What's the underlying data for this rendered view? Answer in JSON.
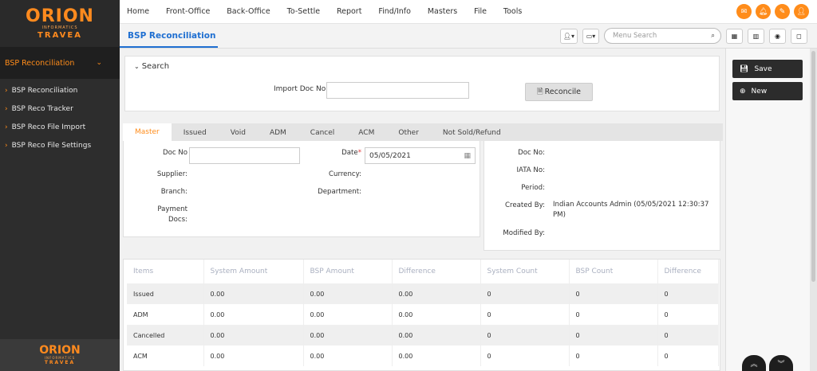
{
  "logo": {
    "line1": "RION",
    "line1_prefix": "O",
    "line2": "INFORMATICS",
    "line3": "TRAVEA"
  },
  "sidebar": {
    "header": "BSP Reconciliation",
    "items": [
      {
        "label": "BSP Reconciliation"
      },
      {
        "label": "BSP Reco Tracker"
      },
      {
        "label": "BSP Reco File Import"
      },
      {
        "label": "BSP Reco File Settings"
      }
    ]
  },
  "nav": {
    "items": [
      "Home",
      "Front-Office",
      "Back-Office",
      "To-Settle",
      "Report",
      "Find/Info",
      "Masters",
      "File",
      "Tools"
    ]
  },
  "topicons": [
    "mail-icon",
    "bell-icon",
    "brush-icon",
    "user-icon"
  ],
  "page": {
    "title": "BSP Reconciliation"
  },
  "toolbar": {
    "menu_search_placeholder": "Menu Search"
  },
  "search": {
    "title": "Search",
    "import_doc_label": "Import Doc No",
    "import_doc_value": "",
    "reconcile_label": "Reconcile"
  },
  "tabs": [
    "Master",
    "Issued",
    "Void",
    "ADM",
    "Cancel",
    "ACM",
    "Other",
    "Not Sold/Refund"
  ],
  "master": {
    "doc_no_label": "Doc No",
    "date_label": "Date",
    "date_required": "*",
    "date_value": "05/05/2021",
    "supplier_label": "Supplier:",
    "currency_label": "Currency:",
    "branch_label": "Branch:",
    "department_label": "Department:",
    "payment_label_1": "Payment",
    "payment_label_2": "Docs:"
  },
  "info": {
    "doc_no_label": "Doc No:",
    "iata_label": "IATA No:",
    "period_label": "Period:",
    "created_by_label": "Created By:",
    "created_by_value_1": "Indian Accounts Admin (05/05/2021 12:30:37",
    "created_by_value_2": "PM)",
    "modified_by_label": "Modified By:"
  },
  "actions": {
    "save_label": "Save",
    "new_label": "New"
  },
  "table": {
    "headers": [
      "Items",
      "System Amount",
      "BSP Amount",
      "Difference",
      "System Count",
      "BSP Count",
      "Difference"
    ],
    "rows": [
      [
        "Issued",
        "0.00",
        "0.00",
        "0.00",
        "0",
        "0",
        "0"
      ],
      [
        "ADM",
        "0.00",
        "0.00",
        "0.00",
        "0",
        "0",
        "0"
      ],
      [
        "Cancelled",
        "0.00",
        "0.00",
        "0.00",
        "0",
        "0",
        "0"
      ],
      [
        "ACM",
        "0.00",
        "0.00",
        "0.00",
        "0",
        "0",
        "0"
      ]
    ]
  }
}
